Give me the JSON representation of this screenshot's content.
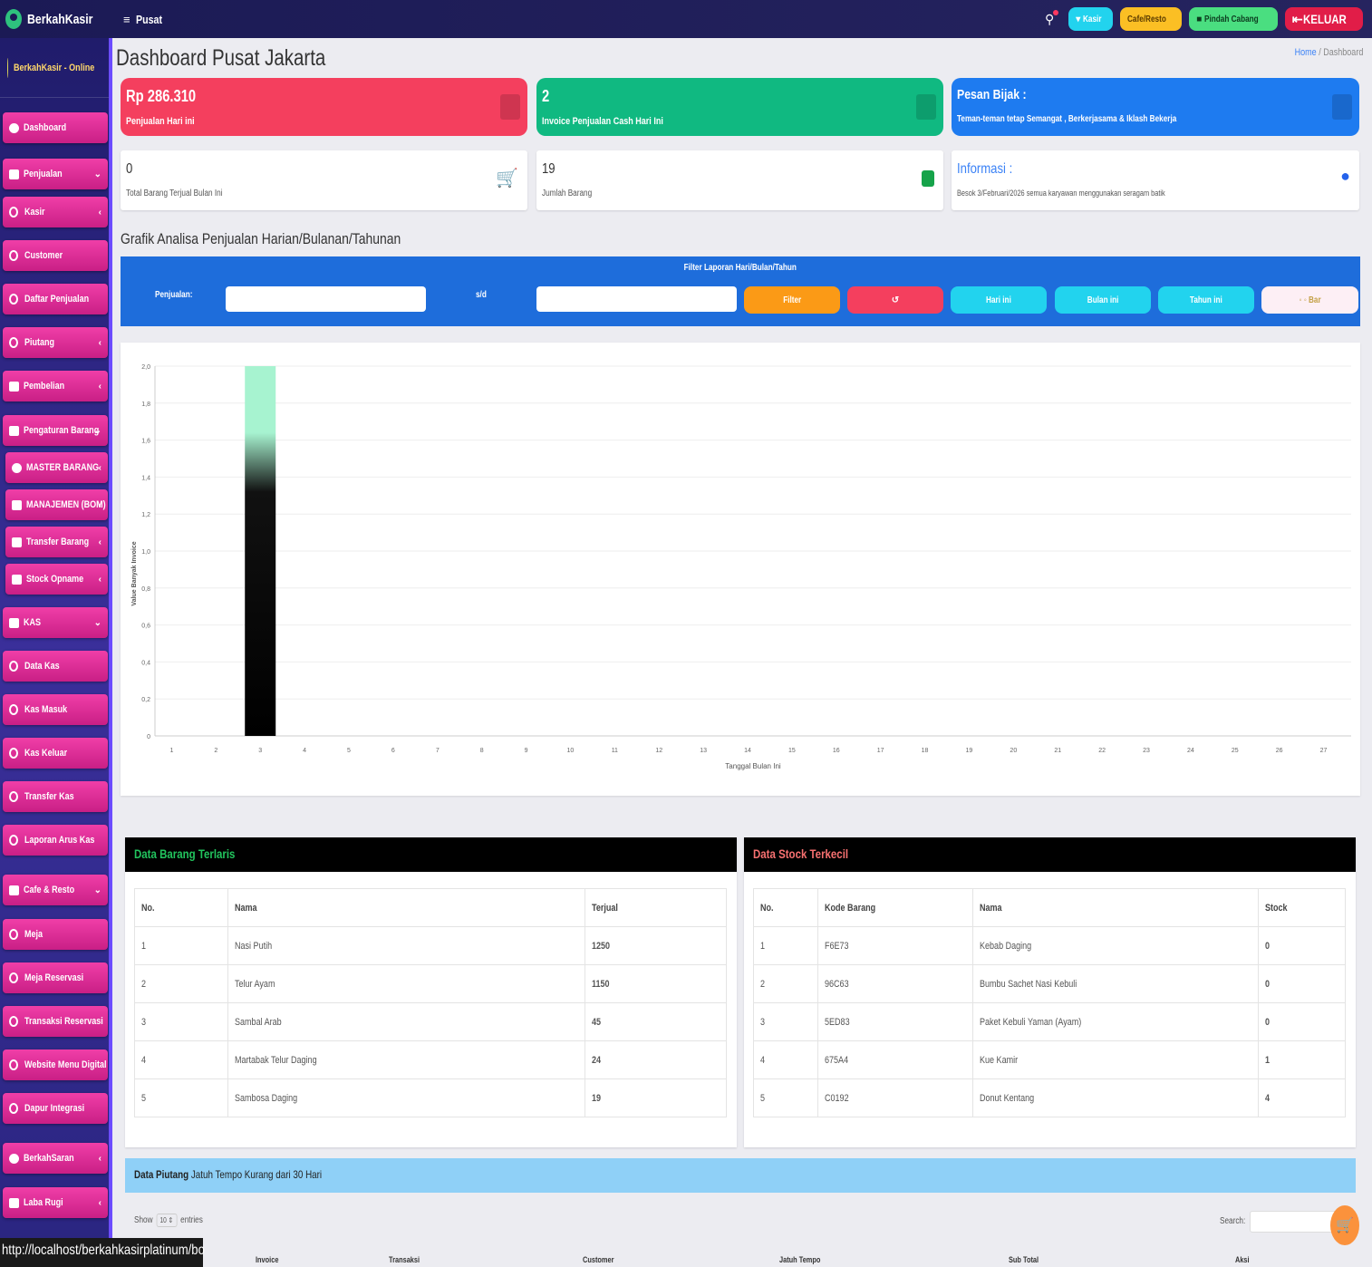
{
  "topbar": {
    "brand": "BerkahKasir",
    "menu_label": "Pusat",
    "btn_kasir": "Kasir",
    "btn_cafe": "Cafe/Resto",
    "btn_pindah": "Pindah Cabang",
    "btn_keluar": "KELUAR"
  },
  "sidebar": {
    "user": "BerkahKasir - Online",
    "items": [
      {
        "label": "Dashboard"
      },
      {
        "label": "Penjualan"
      },
      {
        "label": "Kasir"
      },
      {
        "label": "Customer"
      },
      {
        "label": "Daftar Penjualan"
      },
      {
        "label": "Piutang"
      },
      {
        "label": "Pembelian"
      },
      {
        "label": "Pengaturan Barang"
      },
      {
        "label": "MASTER BARANG"
      },
      {
        "label": "MANAJEMEN (BOM)"
      },
      {
        "label": "Transfer Barang"
      },
      {
        "label": "Stock Opname"
      },
      {
        "label": "KAS"
      },
      {
        "label": "Data Kas"
      },
      {
        "label": "Kas Masuk"
      },
      {
        "label": "Kas Keluar"
      },
      {
        "label": "Transfer Kas"
      },
      {
        "label": "Laporan Arus Kas"
      },
      {
        "label": "Cafe & Resto"
      },
      {
        "label": "Meja"
      },
      {
        "label": "Meja Reservasi"
      },
      {
        "label": "Transaksi Reservasi"
      },
      {
        "label": "Website Menu Digital"
      },
      {
        "label": "Dapur Integrasi"
      },
      {
        "label": "BerkahSaran"
      },
      {
        "label": "Laba Rugi"
      }
    ]
  },
  "page": {
    "title": "Dashboard Pusat Jakarta",
    "breadcrumb_home": "Home",
    "breadcrumb_sep": "/",
    "breadcrumb_current": "Dashboard"
  },
  "stats": {
    "sales_today_value": "Rp 286.310",
    "sales_today_label": "Penjualan Hari ini",
    "invoice_value": "2",
    "invoice_label": "Invoice Penjualan Cash Hari Ini",
    "pesan_title": "Pesan Bijak :",
    "pesan_text": "Teman-teman tetap Semangat , Berkerjasama & Iklash Bekerja",
    "sold_month_value": "0",
    "sold_month_label": "Total Barang Terjual Bulan Ini",
    "jumlah_value": "19",
    "jumlah_label": "Jumlah Barang",
    "info_title": "Informasi :",
    "info_text": "Besok 3/Februari/2026 semua karyawan menggunakan seragam batik"
  },
  "filter": {
    "section_title": "Grafik Analisa Penjualan Harian/Bulanan/Tahunan",
    "bar_title": "Filter Laporan Hari/Bulan/Tahun",
    "label_penjualan": "Penjualan:",
    "label_sd": "s/d",
    "btn_filter": "Filter",
    "btn_reset": "↺",
    "btn_hari": "Hari ini",
    "btn_bulan": "Bulan ini",
    "btn_tahun": "Tahun ini",
    "btn_last": "◦ ◦ Bar"
  },
  "chart_data": {
    "type": "bar",
    "categories": [
      "1",
      "2",
      "3",
      "4",
      "5",
      "6",
      "7",
      "8",
      "9",
      "10",
      "11",
      "12",
      "13",
      "14",
      "15",
      "16",
      "17",
      "18",
      "19",
      "20",
      "21",
      "22",
      "23",
      "24",
      "25",
      "26",
      "27"
    ],
    "values": [
      0,
      0,
      2,
      0,
      0,
      0,
      0,
      0,
      0,
      0,
      0,
      0,
      0,
      0,
      0,
      0,
      0,
      0,
      0,
      0,
      0,
      0,
      0,
      0,
      0,
      0,
      0
    ],
    "ylim": [
      0,
      2.0
    ],
    "yticks": [
      "0",
      "0,2",
      "0,4",
      "0,6",
      "0,8",
      "1,0",
      "1,2",
      "1,4",
      "1,6",
      "1,8",
      "2,0"
    ],
    "xlabel": "Tanggal Bulan Ini",
    "ylabel": "Value Banyak Invoice",
    "grid": true
  },
  "terlaris": {
    "title": "Data Barang Terlaris",
    "headers": [
      "No.",
      "Nama",
      "Terjual"
    ],
    "rows": [
      [
        "1",
        "Nasi Putih",
        "1250"
      ],
      [
        "2",
        "Telur Ayam",
        "1150"
      ],
      [
        "3",
        "Sambal Arab",
        "45"
      ],
      [
        "4",
        "Martabak Telur Daging",
        "24"
      ],
      [
        "5",
        "Sambosa Daging",
        "19"
      ]
    ]
  },
  "stok": {
    "title": "Data Stock Terkecil",
    "headers": [
      "No.",
      "Kode Barang",
      "Nama",
      "Stock"
    ],
    "rows": [
      [
        "1",
        "F6E73",
        "Kebab Daging",
        "0"
      ],
      [
        "2",
        "96C63",
        "Bumbu Sachet Nasi Kebuli",
        "0"
      ],
      [
        "3",
        "5ED83",
        "Paket Kebuli Yaman (Ayam)",
        "0"
      ],
      [
        "4",
        "675A4",
        "Kue Kamir",
        "1"
      ],
      [
        "5",
        "C0192",
        "Donut Kentang",
        "4"
      ]
    ]
  },
  "piutang": {
    "title_bold": "Data Piutang",
    "title_rest": "Jatuh Tempo Kurang dari 30 Hari",
    "show_label": "Show",
    "show_value": "10",
    "entries_label": "entries",
    "search_label": "Search:",
    "headers": [
      "Invoice",
      "Transaksi",
      "Customer",
      "Jatuh Tempo",
      "Sub Total",
      "Aksi"
    ]
  },
  "statusbar": {
    "url": "http://localhost/berkahkasirplatinum/bo"
  },
  "colors": {
    "red_box": "#f43f5e",
    "green_box": "#10b981",
    "blue_box": "#1e7bf0",
    "sidebar_item": "#e0319a"
  }
}
